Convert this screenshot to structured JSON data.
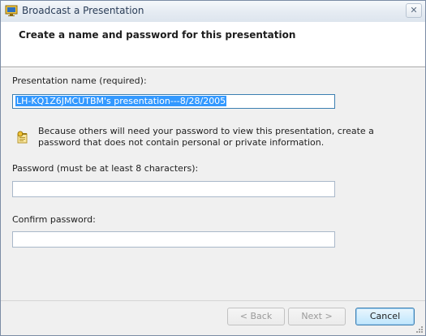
{
  "window": {
    "title": "Broadcast a Presentation",
    "close_glyph": "✕",
    "icon": "broadcast-presentation-icon"
  },
  "header": {
    "title": "Create a name and password for this presentation"
  },
  "form": {
    "name_label": "Presentation name (required):",
    "name_value": "LH-KQ1Z6JMCUTBM's presentation---8/28/2005",
    "info_icon": "key-info-icon",
    "info_text": "Because others will need your password to view this presentation, create a password that does not contain personal or private information.",
    "password_label": "Password (must be at least 8 characters):",
    "password_value": "",
    "confirm_label": "Confirm password:",
    "confirm_value": ""
  },
  "buttons": {
    "back": "< Back",
    "next": "Next >",
    "cancel": "Cancel"
  },
  "colors": {
    "selection": "#3399ff",
    "focus_border": "#3c7fb1",
    "window_bg": "#f0f0f0"
  }
}
